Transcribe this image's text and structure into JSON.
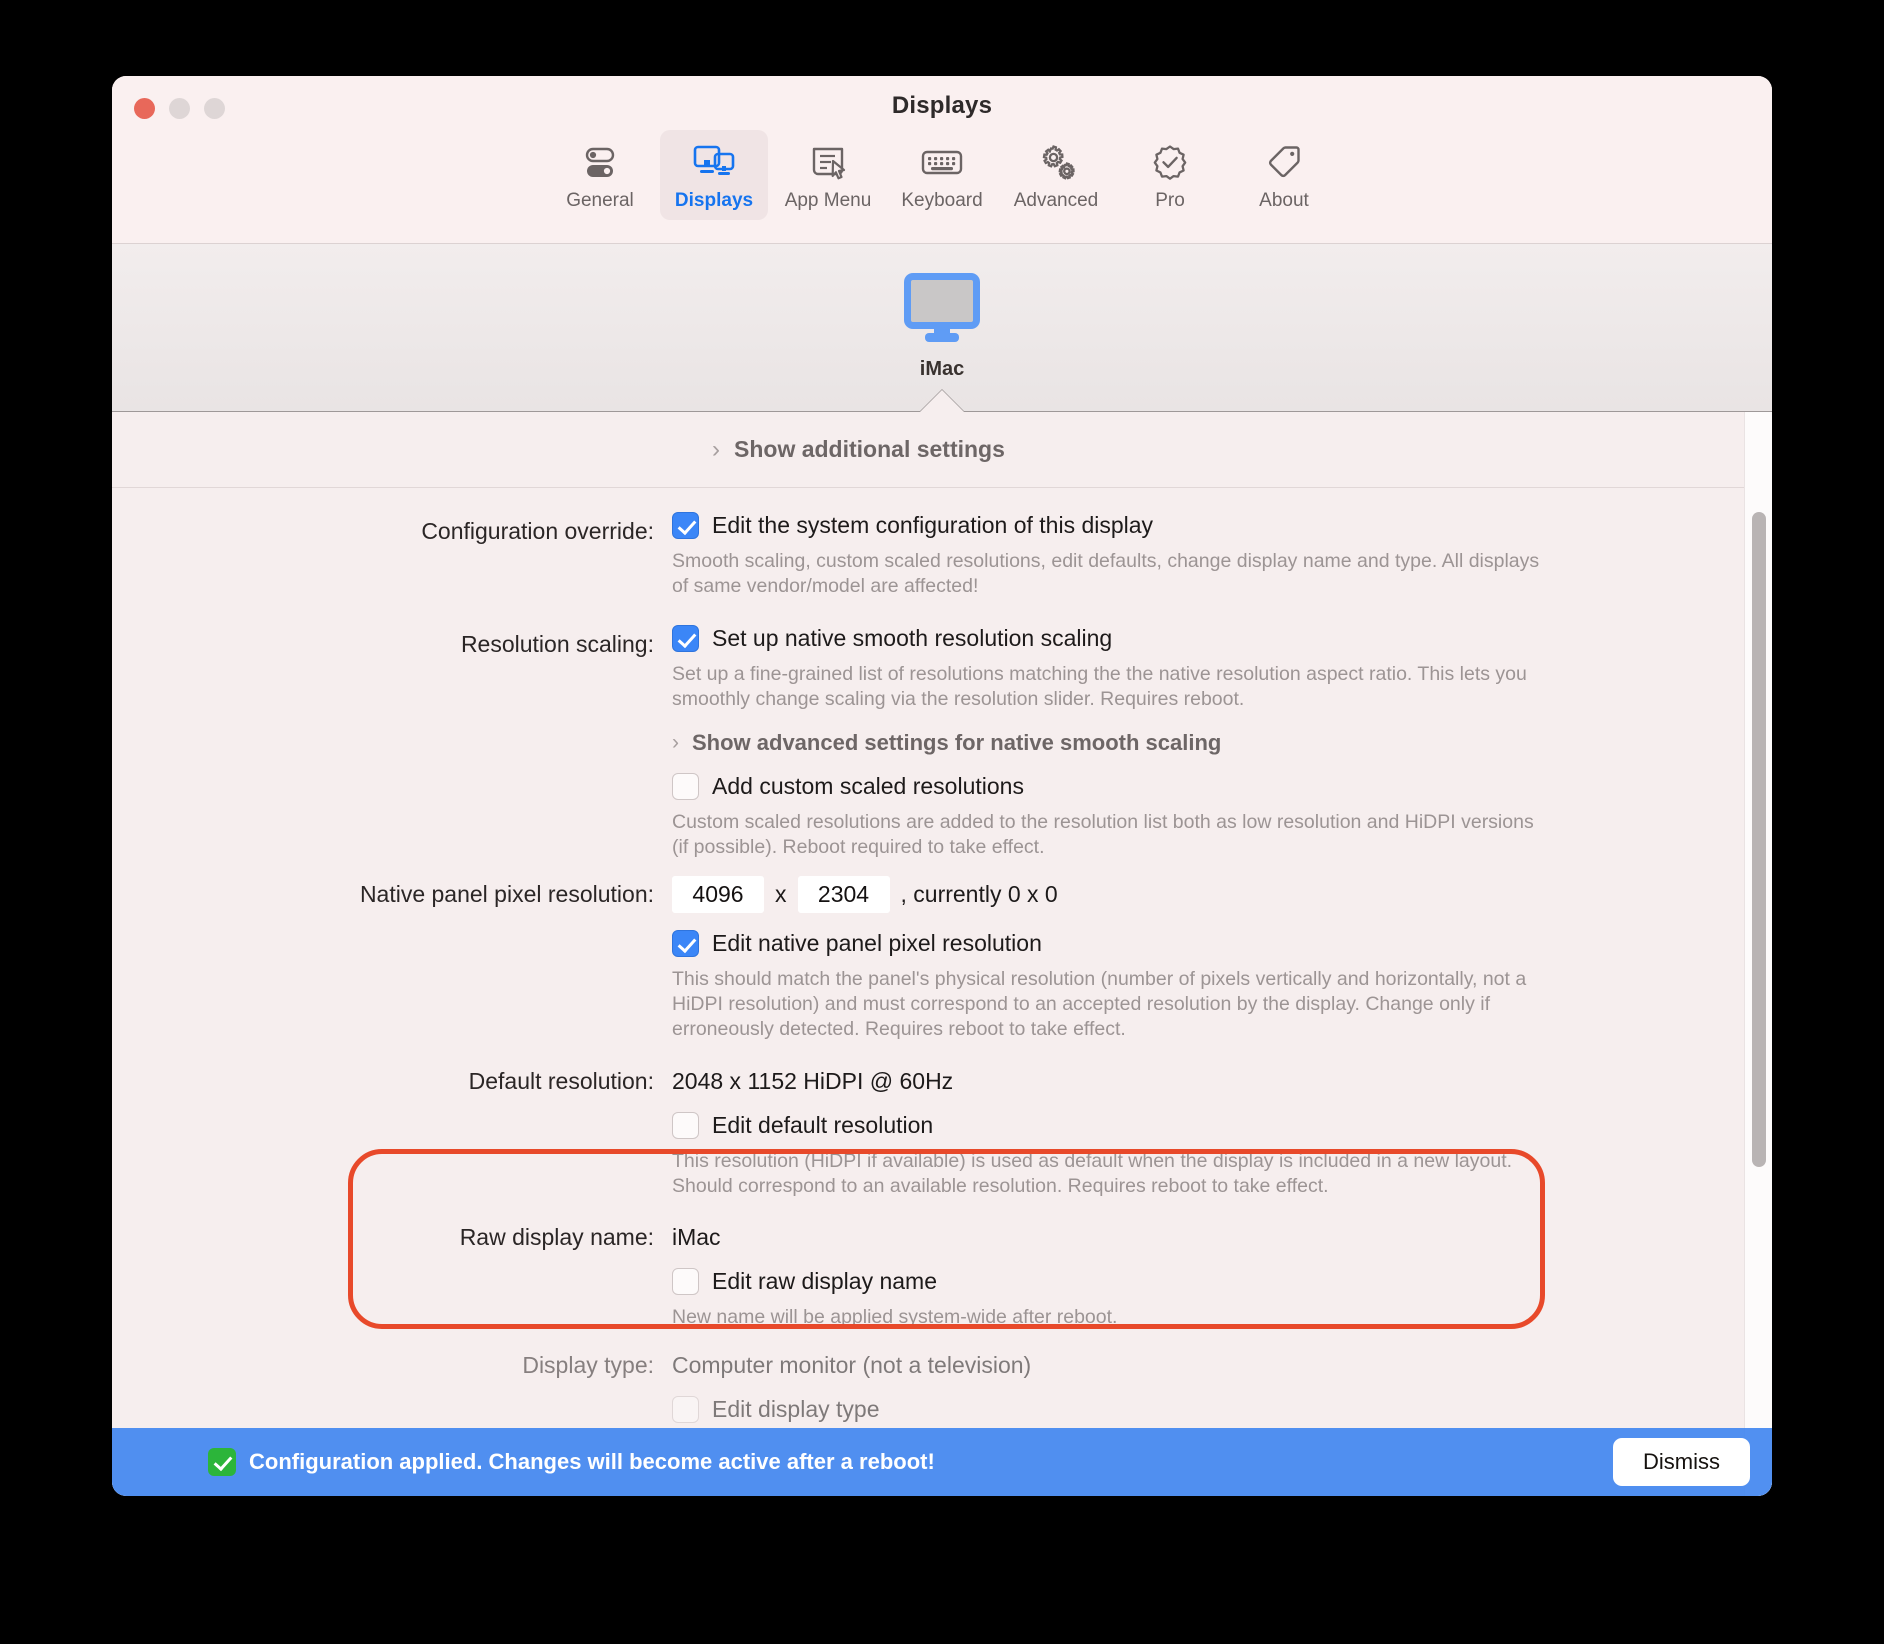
{
  "window": {
    "title": "Displays",
    "traffic_lights": [
      "close",
      "minimize",
      "zoom"
    ]
  },
  "toolbar": {
    "tabs": [
      {
        "label": "General",
        "icon": "toggles-icon",
        "active": false
      },
      {
        "label": "Displays",
        "icon": "displays-icon",
        "active": true
      },
      {
        "label": "App Menu",
        "icon": "menu-cursor-icon",
        "active": false
      },
      {
        "label": "Keyboard",
        "icon": "keyboard-icon",
        "active": false
      },
      {
        "label": "Advanced",
        "icon": "gears-icon",
        "active": false
      },
      {
        "label": "Pro",
        "icon": "seal-check-icon",
        "active": false
      },
      {
        "label": "About",
        "icon": "tag-icon",
        "active": false
      }
    ]
  },
  "display_strip": {
    "displays": [
      {
        "name": "iMac",
        "icon": "imac-monitor-icon",
        "selected": true
      }
    ]
  },
  "disclosure": {
    "additional_settings_label": "Show additional settings",
    "chevron": "›"
  },
  "settings": {
    "configuration_override": {
      "label": "Configuration override:",
      "checkbox_label": "Edit the system configuration of this display",
      "checked": true,
      "hint": "Smooth scaling, custom scaled resolutions, edit defaults, change display name and type. All displays of same vendor/model are affected!"
    },
    "resolution_scaling": {
      "label": "Resolution scaling:",
      "checkbox_label": "Set up native smooth resolution scaling",
      "checked": true,
      "hint": "Set up a fine-grained list of resolutions matching the the native resolution aspect ratio. This lets you smoothly change scaling via the resolution slider. Requires reboot.",
      "advanced_disclosure_label": "Show advanced settings for native smooth scaling",
      "custom_checkbox_label": "Add custom scaled resolutions",
      "custom_checked": false,
      "custom_hint": "Custom scaled resolutions are added to the resolution list both as low resolution and HiDPI versions (if possible). Reboot required to take effect."
    },
    "native_panel": {
      "label": "Native panel pixel resolution:",
      "width_value": "4096",
      "height_value": "2304",
      "separator": "x",
      "currently_text": ", currently 0 x 0",
      "checkbox_label": "Edit native panel pixel resolution",
      "checked": true,
      "hint": "This should match the panel's physical resolution (number of pixels vertically and horizontally, not a HiDPI resolution) and must correspond to an accepted resolution by the display. Change only if erroneously detected. Requires reboot to take effect.",
      "highlight_color": "#e8492a"
    },
    "default_resolution": {
      "label": "Default resolution:",
      "value": "2048 x 1152 HiDPI @ 60Hz",
      "checkbox_label": "Edit default resolution",
      "checked": false,
      "hint": "This resolution (HiDPI if available) is used as default when the display is included in a new layout. Should correspond to an available resolution. Requires reboot to take effect."
    },
    "raw_display_name": {
      "label": "Raw display name:",
      "value": "iMac",
      "checkbox_label": "Edit raw display name",
      "checked": false,
      "hint": "New name will be applied system-wide after reboot."
    },
    "display_type": {
      "label": "Display type:",
      "value": "Computer monitor (not a television)",
      "checkbox_label": "Edit display type",
      "checked": false
    }
  },
  "banner": {
    "icon": "green-check-icon",
    "message": "Configuration applied. Changes will become active after a reboot!",
    "dismiss_label": "Dismiss",
    "background_color": "#3e84f0"
  },
  "colors": {
    "accent_blue": "#1674ef",
    "checkbox_blue": "#3b86f7",
    "highlight_red": "#e8492a",
    "window_bg": "#f6eeee"
  }
}
